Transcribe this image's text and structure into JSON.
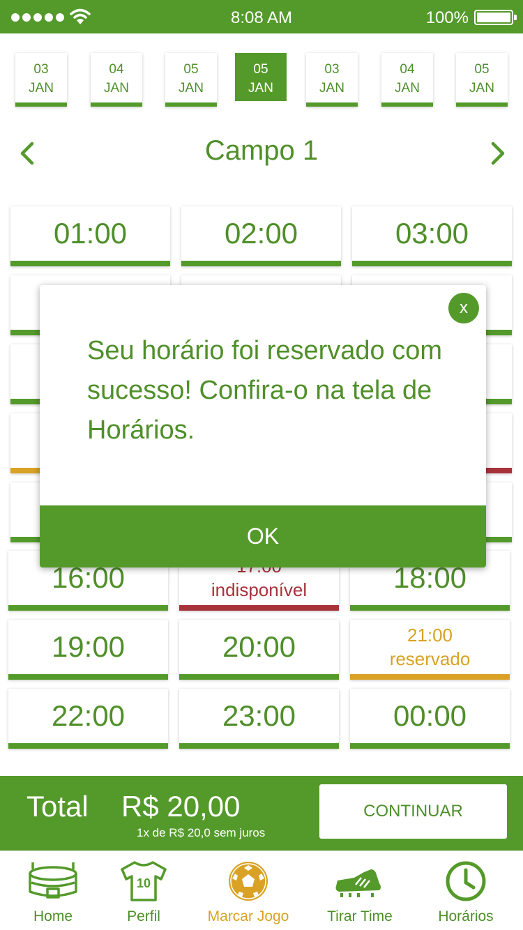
{
  "status_bar": {
    "time": "8:08 AM",
    "battery": "100%"
  },
  "dates": [
    {
      "day": "03",
      "month": "JAN",
      "active": false
    },
    {
      "day": "04",
      "month": "JAN",
      "active": false
    },
    {
      "day": "05",
      "month": "JAN",
      "active": false
    },
    {
      "day": "05",
      "month": "JAN",
      "active": true
    },
    {
      "day": "03",
      "month": "JAN",
      "active": false
    },
    {
      "day": "04",
      "month": "JAN",
      "active": false
    },
    {
      "day": "05",
      "month": "JAN",
      "active": false
    }
  ],
  "field": {
    "title": "Campo 1"
  },
  "slots": [
    {
      "time": "01:00",
      "status": ""
    },
    {
      "time": "02:00",
      "status": ""
    },
    {
      "time": "03:00",
      "status": ""
    },
    {
      "time": "16:00",
      "status": ""
    },
    {
      "time": "17:00",
      "status": "indisponível"
    },
    {
      "time": "18:00",
      "status": ""
    },
    {
      "time": "19:00",
      "status": ""
    },
    {
      "time": "20:00",
      "status": ""
    },
    {
      "time": "21:00",
      "status": "reservado"
    },
    {
      "time": "22:00",
      "status": ""
    },
    {
      "time": "23:00",
      "status": ""
    },
    {
      "time": "00:00",
      "status": ""
    }
  ],
  "modal": {
    "close_label": "x",
    "message": "Seu horário foi reservado com sucesso! Confira-o na tela de Horários.",
    "ok_label": "OK"
  },
  "footer": {
    "total_label": "Total",
    "total_value": "R$ 20,00",
    "installments": "1x de R$ 20,0 sem juros",
    "continue_label": "CONTINUAR"
  },
  "tabs": [
    {
      "label": "Home",
      "icon": "stadium-icon",
      "active": false
    },
    {
      "label": "Perfil",
      "icon": "jersey-icon",
      "active": false
    },
    {
      "label": "Marcar Jogo",
      "icon": "soccer-ball-icon",
      "active": true
    },
    {
      "label": "Tirar Time",
      "icon": "cleat-icon",
      "active": false
    },
    {
      "label": "Horários",
      "icon": "clock-icon",
      "active": false
    }
  ],
  "colors": {
    "green": "#549a2b",
    "text_green": "#4f8f2a",
    "gold": "#d9a225",
    "red": "#a8323a"
  }
}
